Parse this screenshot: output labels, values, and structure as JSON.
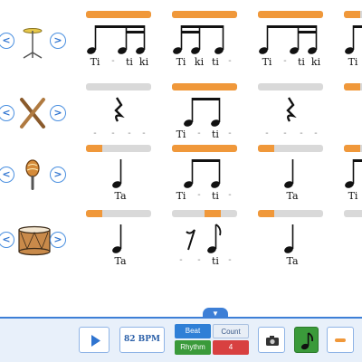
{
  "navigation": {
    "prev_glyph": "<",
    "next_glyph": ">"
  },
  "rows": [
    {
      "instrument": "cymbal-icon",
      "measures": [
        {
          "progress": [
            0,
            0.25,
            0.5,
            0.75
          ],
          "syllables": [
            "Ti",
            "-",
            "ti",
            "ki"
          ]
        },
        {
          "progress": [
            0,
            0.25,
            0.5,
            0.75
          ],
          "syllables": [
            "Ti",
            "ki",
            "ti",
            "-"
          ]
        },
        {
          "progress": [
            0,
            0.25,
            0.5,
            0.75
          ],
          "syllables": [
            "Ti",
            "-",
            "ti",
            "ki"
          ]
        },
        {
          "progress": [
            0
          ],
          "syllables": [
            "Ti"
          ]
        }
      ]
    },
    {
      "instrument": "sticks-icon",
      "measures": [
        {
          "progress": [],
          "syllables": [
            "-",
            "-",
            "-",
            "-"
          ]
        },
        {
          "progress": [
            0,
            0.25,
            0.5,
            0.75
          ],
          "syllables": [
            "Ti",
            "-",
            "ti",
            "-"
          ]
        },
        {
          "progress": [],
          "syllables": [
            "-",
            "-",
            "-",
            "-"
          ]
        },
        {
          "progress": [
            0
          ],
          "syllables": []
        }
      ]
    },
    {
      "instrument": "maraca-icon",
      "measures": [
        {
          "progress": [
            0
          ],
          "syllables": [
            "Ta"
          ]
        },
        {
          "progress": [
            0,
            0.25,
            0.5,
            0.75
          ],
          "syllables": [
            "Ti",
            "-",
            "ti",
            "-"
          ]
        },
        {
          "progress": [
            0
          ],
          "syllables": [
            "Ta"
          ]
        },
        {
          "progress": [
            0
          ],
          "syllables": [
            "Ti"
          ]
        }
      ]
    },
    {
      "instrument": "drum-icon",
      "measures": [
        {
          "progress": [
            0
          ],
          "syllables": [
            "Ta"
          ]
        },
        {
          "progress": [
            0.5
          ],
          "syllables": [
            "-",
            "-",
            "ti",
            "-"
          ]
        },
        {
          "progress": [
            0
          ],
          "syllables": [
            "Ta"
          ]
        },
        {
          "progress": [],
          "syllables": []
        }
      ]
    }
  ],
  "toolbar": {
    "collapse_glyph": "▼",
    "bpm_label": "82 BPM",
    "beat_label": "Beat",
    "count_label": "Count",
    "rhythm_label": "Rhythm",
    "count_value": "4",
    "play_icon": "play-icon",
    "camera_icon": "camera-icon",
    "note_icon": "eighth-note-icon"
  },
  "colors": {
    "accent": "#3d7fd6",
    "progress": "#f0983a",
    "track": "#d9d9d9",
    "green": "#3a9a3a",
    "red": "#d84040"
  }
}
